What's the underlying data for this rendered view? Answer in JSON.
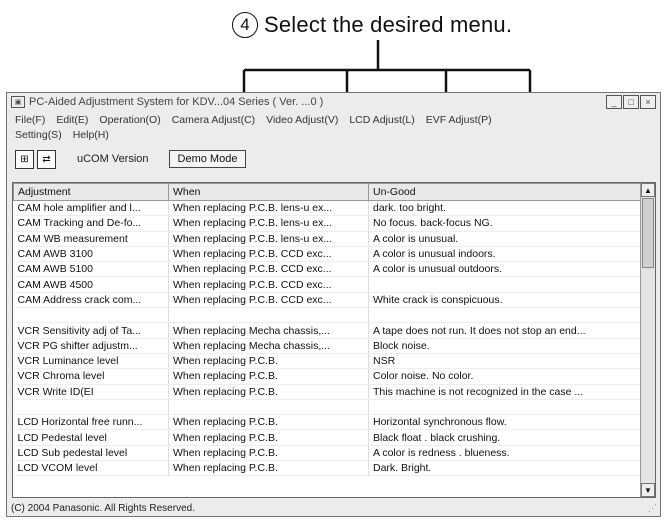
{
  "callout": {
    "number": "4",
    "text": "Select the desired menu."
  },
  "window": {
    "title": "PC-Aided Adjustment System for KDV...04 Series  ( Ver. ...0 )",
    "controls": {
      "minimize": "_",
      "maximize": "□",
      "close": "×"
    }
  },
  "menu": {
    "row1": [
      "File(F)",
      "Edit(E)",
      "Operation(O)",
      "Camera Adjust(C)",
      "Video Adjust(V)",
      "LCD Adjust(L)",
      "EVF Adjust(P)"
    ],
    "row2": [
      "Setting(S)",
      "Help(H)"
    ]
  },
  "toolbar": {
    "ucom_label": "uCOM Version",
    "mode": "Demo Mode"
  },
  "table": {
    "headers": [
      "Adjustment",
      "When",
      "Un-Good"
    ],
    "rows": [
      [
        "CAM hole amplifier and l...",
        "When replacing P.C.B. lens-u ex...",
        "dark. too bright."
      ],
      [
        "CAM Tracking and De-fo...",
        "When replacing P.C.B. lens-u ex...",
        "No focus. back-focus NG."
      ],
      [
        "CAM WB measurement",
        "When replacing P.C.B. lens-u ex...",
        "A color is unusual."
      ],
      [
        "CAM AWB 3100",
        "When replacing P.C.B. CCD exc...",
        "A color is unusual indoors."
      ],
      [
        "CAM AWB 5100",
        "When replacing P.C.B. CCD exc...",
        "A color is unusual outdoors."
      ],
      [
        "CAM AWB 4500",
        "When replacing P.C.B. CCD exc...",
        ""
      ],
      [
        "CAM Address crack com...",
        "When replacing P.C.B. CCD exc...",
        "White crack is conspicuous."
      ],
      [
        "",
        "",
        ""
      ],
      [
        "VCR Sensitivity adj of Ta...",
        "When replacing Mecha chassis,...",
        "A tape does not run. It does not stop an end..."
      ],
      [
        "VCR PG shifter adjustm...",
        "When replacing Mecha chassis,...",
        "Block noise."
      ],
      [
        "VCR Luminance level",
        "When replacing P.C.B.",
        "NSR"
      ],
      [
        "VCR Chroma level",
        "When replacing P.C.B.",
        "Color noise. No color."
      ],
      [
        "VCR Write ID(EI",
        "When replacing P.C.B.",
        "This machine is not recognized in the case ..."
      ],
      [
        "",
        "",
        ""
      ],
      [
        "LCD Horizontal free runn...",
        "When replacing P.C.B.",
        "Horizontal synchronous flow."
      ],
      [
        "LCD Pedestal level",
        "When replacing P.C.B.",
        "Black float . black crushing."
      ],
      [
        "LCD Sub pedestal level",
        "When replacing P.C.B.",
        "A color is redness . blueness."
      ],
      [
        "LCD VCOM level",
        "When replacing P.C.B.",
        "Dark. Bright."
      ]
    ]
  },
  "status": {
    "text": "(C) 2004 Panasonic. All Rights Reserved."
  }
}
